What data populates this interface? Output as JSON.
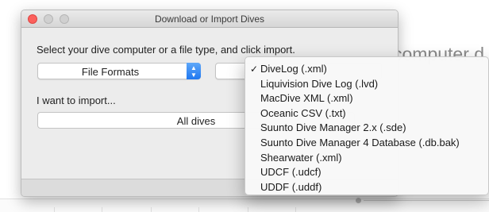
{
  "background": {
    "heading_fragment": "computer d"
  },
  "dialog": {
    "window_title": "Download or Import Dives",
    "instructions": "Select your dive computer or a file type, and click import.",
    "file_type_popup": {
      "selected": "File Formats",
      "icon": "up-down-chevrons-icon"
    },
    "import_label": "I want to import...",
    "import_scope": "All dives"
  },
  "menu": {
    "items": [
      {
        "label": "DiveLog (.xml)",
        "checked": true
      },
      {
        "label": "Liquivision Dive Log (.lvd)",
        "checked": false
      },
      {
        "label": "MacDive XML (.xml)",
        "checked": false
      },
      {
        "label": "Oceanic CSV (.txt)",
        "checked": false
      },
      {
        "label": "Suunto Dive Manager 2.x (.sde)",
        "checked": false
      },
      {
        "label": "Suunto Dive Manager 4 Database (.db.bak)",
        "checked": false
      },
      {
        "label": "Shearwater (.xml)",
        "checked": false
      },
      {
        "label": "UDCF (.udcf)",
        "checked": false
      },
      {
        "label": "UDDF (.uddf)",
        "checked": false
      }
    ],
    "check_glyph": "✓"
  },
  "colors": {
    "accent": "#1f78f0",
    "close": "#fc605c"
  }
}
